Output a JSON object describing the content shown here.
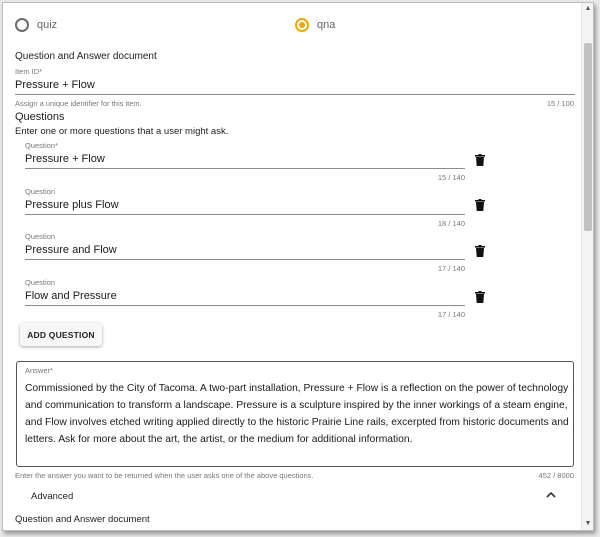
{
  "type_options": [
    {
      "label": "quiz",
      "selected": false
    },
    {
      "label": "qna",
      "selected": true
    }
  ],
  "document_type_label": "Question and Answer document",
  "item_id": {
    "label": "Item ID*",
    "value": "Pressure + Flow",
    "hint": "Assign a unique identifier for this item.",
    "counter": "15 / 100"
  },
  "questions_section": {
    "title": "Questions",
    "description": "Enter one or more questions that a user might ask."
  },
  "questions": [
    {
      "label": "Question*",
      "value": "Pressure + Flow",
      "counter": "15 / 140"
    },
    {
      "label": "Question",
      "value": "Pressure plus Flow",
      "counter": "18 / 140"
    },
    {
      "label": "Question",
      "value": "Pressure and Flow",
      "counter": "17 / 140"
    },
    {
      "label": "Question",
      "value": "Flow and Pressure",
      "counter": "17 / 140"
    }
  ],
  "add_question_label": "ADD QUESTION",
  "answer": {
    "label": "Answer*",
    "value": "Commissioned by the City of Tacoma. A two-part installation, Pressure + Flow is a reflection on the power of technology and communication to transform a landscape. Pressure is a sculpture inspired by the inner workings of a steam engine, and Flow involves etched writing applied directly to the historic Prairie Line rails, excerpted from historic documents and letters. Ask for more about the art, the artist, or the medium for additional information.",
    "hint": "Enter the answer you want to be returned when the user asks one of the above questions.",
    "counter": "452 / 8000"
  },
  "advanced_label": "Advanced",
  "footer_document_type_label": "Question and Answer document",
  "colors": {
    "accent": "#f0a800",
    "underline": "#8c8c8c",
    "hint_text": "#777777"
  },
  "icons": {
    "delete": "trash-icon",
    "collapse": "chevron-up-icon"
  }
}
